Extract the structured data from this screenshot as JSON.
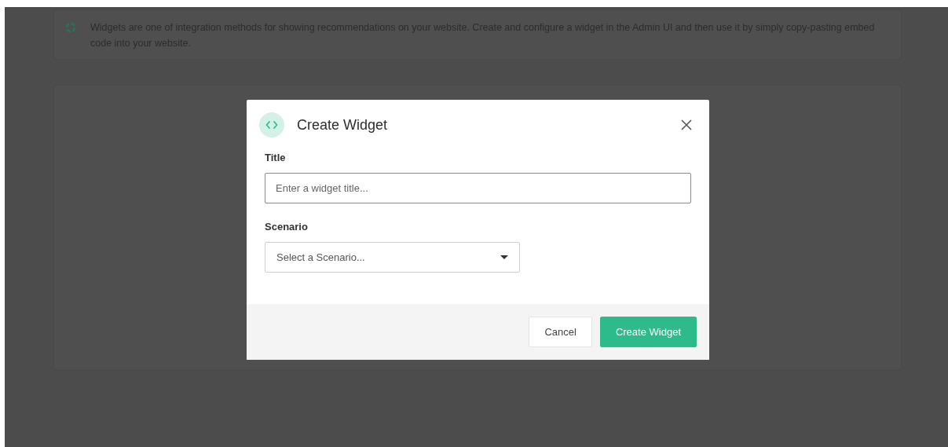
{
  "info_banner": {
    "text": "Widgets are one of integration methods for showing recommendations on your website. Create and configure a widget in the Admin UI and then use it by simply copy-pasting embed code into your website."
  },
  "dialog": {
    "title": "Create Widget",
    "fields": [
      {
        "kind": "text",
        "label": "Title",
        "placeholder": "Enter a widget title..."
      },
      {
        "kind": "select",
        "label": "Scenario",
        "placeholder": "Select a Scenario..."
      }
    ],
    "buttons": [
      {
        "kind": "secondary",
        "label": "Cancel"
      },
      {
        "kind": "primary",
        "label": "Create Widget"
      }
    ]
  }
}
